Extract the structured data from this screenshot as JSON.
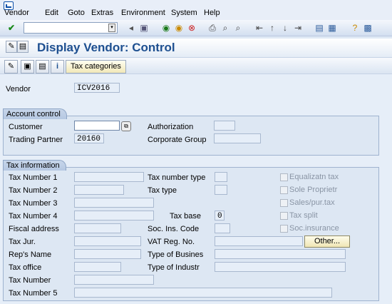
{
  "menu": {
    "items": [
      "Vendor",
      "Edit",
      "Goto",
      "Extras",
      "Environment",
      "System",
      "Help"
    ]
  },
  "toolbar": {
    "command_value": "",
    "icons": [
      "enter-icon",
      "save-icon",
      "back-icon",
      "exit-icon",
      "cancel-icon",
      "print-icon",
      "find-icon",
      "find-next-icon",
      "first-page-icon",
      "prev-page-icon",
      "next-page-icon",
      "last-page-icon",
      "new-session-icon",
      "shortcut-icon",
      "help-icon",
      "customize-icon"
    ]
  },
  "title": "Display Vendor: Control",
  "app_toolbar": {
    "tax_categories": "Tax categories"
  },
  "vendor": {
    "label": "Vendor",
    "value": "ICV2016"
  },
  "account_control": {
    "header": "Account control",
    "customer_label": "Customer",
    "customer_value": "",
    "authorization_label": "Authorization",
    "authorization_value": "",
    "trading_partner_label": "Trading Partner",
    "trading_partner_value": "20160",
    "corporate_group_label": "Corporate Group",
    "corporate_group_value": ""
  },
  "tax_information": {
    "header": "Tax information",
    "tax_number_1": "Tax Number 1",
    "tax_number_2": "Tax Number 2",
    "tax_number_3": "Tax Number 3",
    "tax_number_4": "Tax Number 4",
    "fiscal_address": "Fiscal address",
    "tax_jur": "Tax Jur.",
    "reps_name": "Rep's Name",
    "tax_office": "Tax office",
    "tax_number": "Tax Number",
    "tax_number_5": "Tax Number 5",
    "tax_number_type": "Tax number type",
    "tax_type": "Tax type",
    "tax_base": "Tax base",
    "tax_base_value": "0",
    "soc_ins_code": "Soc. Ins. Code",
    "vat_reg_no": "VAT Reg. No.",
    "type_of_business": "Type of Busines",
    "type_of_industry": "Type of Industr",
    "other_button": "Other...",
    "checkboxes": [
      "Equalizatn tax",
      "Sole Proprietr",
      "Sales/pur.tax",
      "Tax split",
      "Soc.insurance"
    ]
  }
}
